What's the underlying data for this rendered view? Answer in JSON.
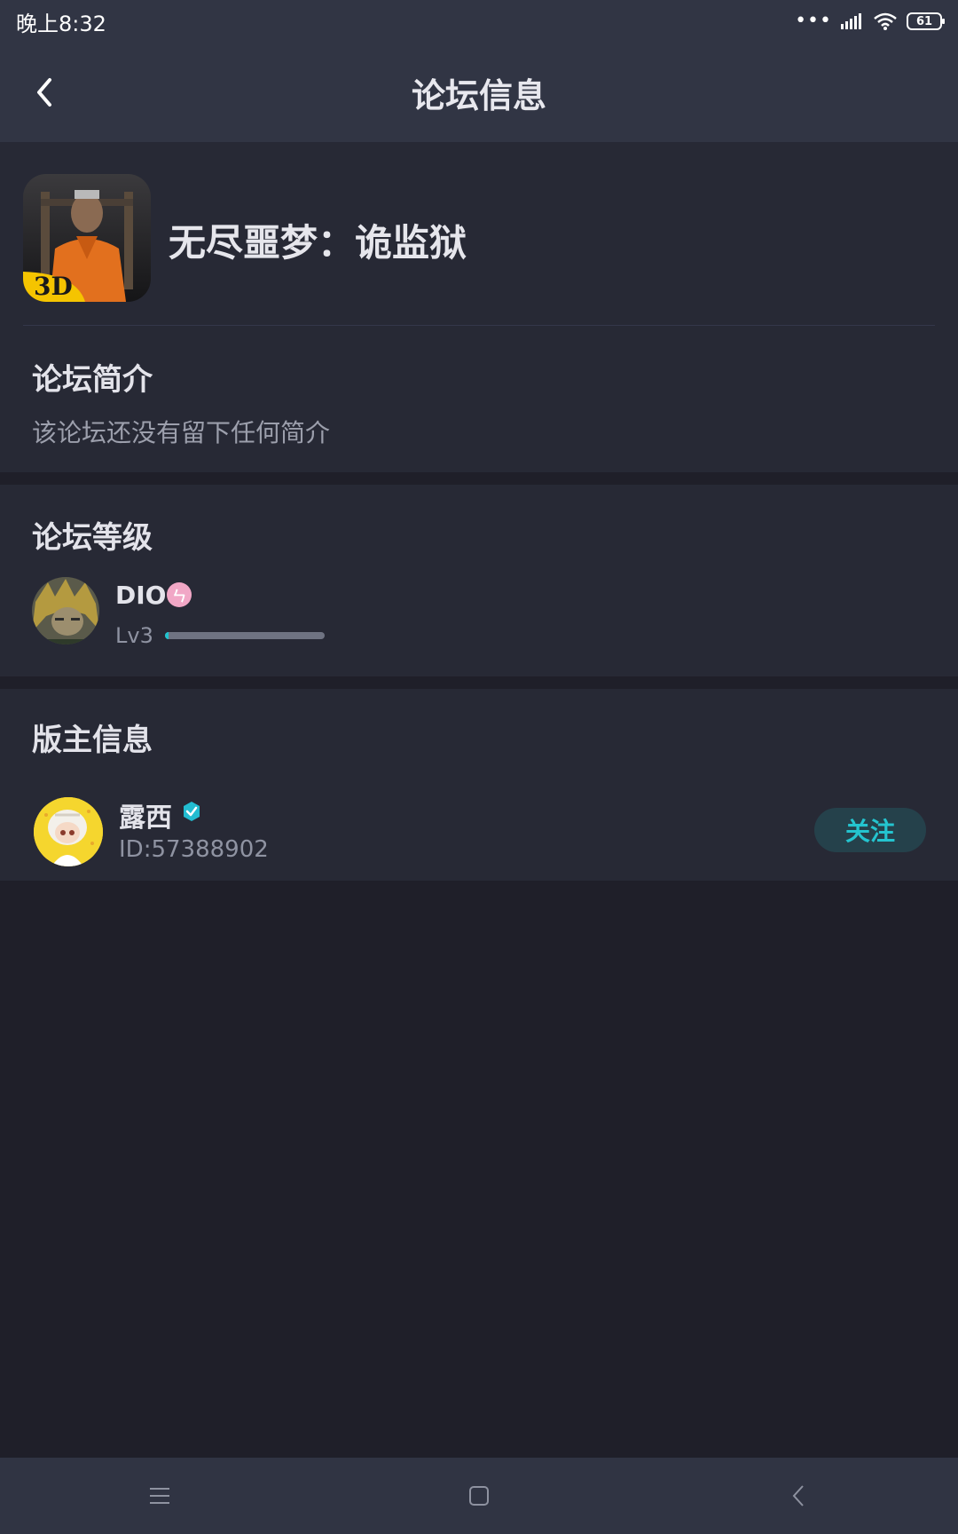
{
  "status_bar": {
    "time": "晚上8:32",
    "battery": "61"
  },
  "header": {
    "title": "论坛信息",
    "back_icon": "chevron-left-icon"
  },
  "forum": {
    "name": "无尽噩梦：诡监狱",
    "icon_badge": "3D",
    "intro_title": "论坛简介",
    "intro_text": "该论坛还没有留下任何简介"
  },
  "level": {
    "title": "论坛等级",
    "user_name": "DIO",
    "badge_icon": "pink-badge-icon",
    "level_label": "Lv3",
    "progress": 0.02,
    "progress_color": "#20c3cf"
  },
  "moderator": {
    "title": "版主信息",
    "name": "露西",
    "id": "ID:57388902",
    "follow_label": "关注",
    "accent": "#24c4cf"
  },
  "nav": {
    "menu_icon": "menu-icon",
    "home_icon": "home-square-icon",
    "back_icon": "back-triangle-icon"
  }
}
